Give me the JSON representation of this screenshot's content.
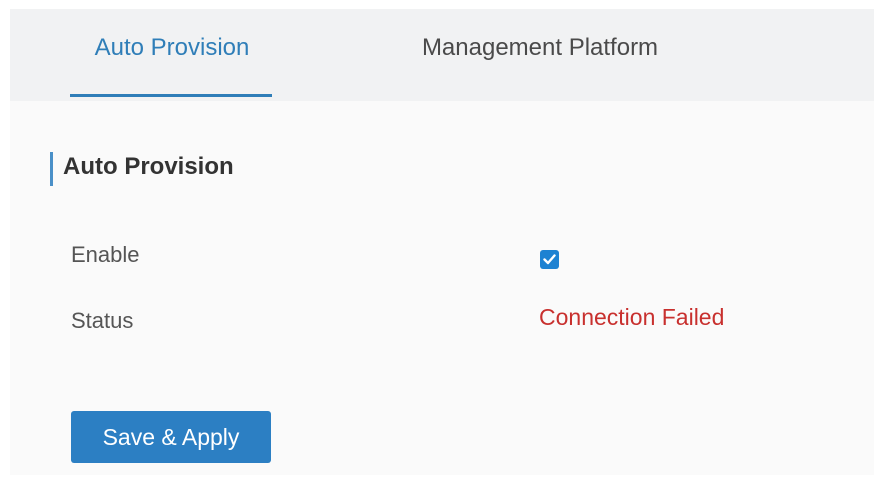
{
  "tabs": [
    {
      "label": "Auto Provision",
      "active": true
    },
    {
      "label": "Management Platform",
      "active": false
    }
  ],
  "section": {
    "title": "Auto Provision"
  },
  "fields": {
    "enable": {
      "label": "Enable",
      "checked": true
    },
    "status": {
      "label": "Status",
      "value": "Connection Failed"
    }
  },
  "actions": {
    "save_label": "Save & Apply"
  },
  "colors": {
    "accent": "#2f7eb8",
    "button": "#2c7fc3",
    "checkbox": "#1e82d2",
    "status_error": "#c8302e"
  },
  "icons": {
    "checkbox": "checkmark-icon"
  }
}
